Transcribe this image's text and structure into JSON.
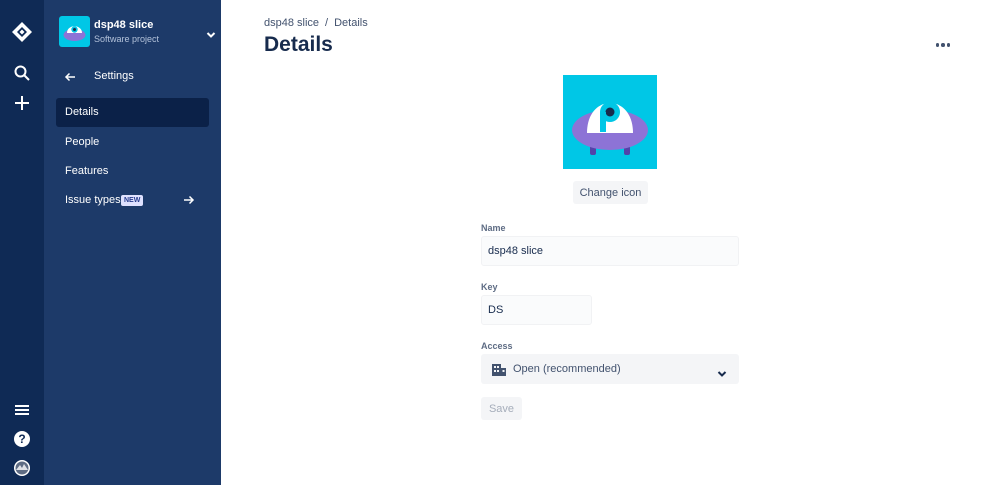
{
  "rail": {
    "icons": [
      "jira-logo-icon",
      "search-icon",
      "create-plus-icon",
      "menu-icon",
      "help-icon",
      "profile-avatar-icon"
    ]
  },
  "sidebar": {
    "project_name": "dsp48 slice",
    "project_type": "Software project",
    "back_label": "Settings",
    "items": [
      {
        "label": "Details",
        "active": true
      },
      {
        "label": "People"
      },
      {
        "label": "Features"
      },
      {
        "label": "Issue types",
        "badge": "NEW"
      }
    ]
  },
  "breadcrumb": {
    "project": "dsp48 slice",
    "separator": "/",
    "current": "Details"
  },
  "page": {
    "title": "Details",
    "change_icon_label": "Change icon"
  },
  "form": {
    "name_label": "Name",
    "name_value": "dsp48 slice",
    "key_label": "Key",
    "key_value": "DS",
    "access_label": "Access",
    "access_value": "Open (recommended)",
    "save_label": "Save"
  },
  "colors": {
    "rail": "#0f2a55",
    "sidebar": "#1d3a69",
    "active_item": "#0b2148",
    "icon_bg": "#00c7e6",
    "ufo_purple": "#8d73d6"
  }
}
